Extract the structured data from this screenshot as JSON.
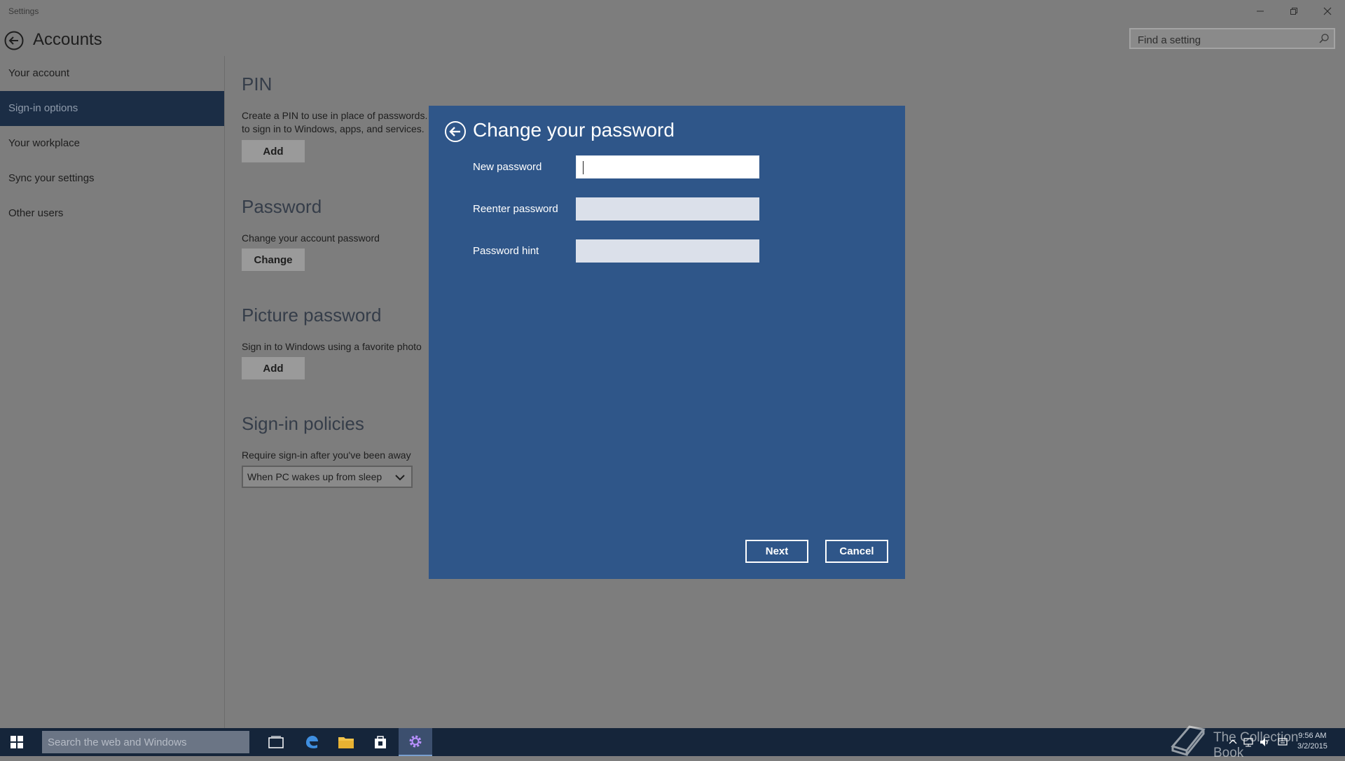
{
  "window": {
    "title": "Settings"
  },
  "header": {
    "title": "Accounts",
    "search_placeholder": "Find a setting"
  },
  "sidebar": {
    "items": [
      {
        "label": "Your account"
      },
      {
        "label": "Sign-in options",
        "active": true
      },
      {
        "label": "Your workplace"
      },
      {
        "label": "Sync your settings"
      },
      {
        "label": "Other users"
      }
    ]
  },
  "main": {
    "pin": {
      "title": "PIN",
      "desc_line1": "Create a PIN to use in place of passwords.",
      "desc_line2": "to sign in to Windows, apps, and services.",
      "button": "Add"
    },
    "password": {
      "title": "Password",
      "desc": "Change your account password",
      "button": "Change"
    },
    "picture_password": {
      "title": "Picture password",
      "desc": "Sign in to Windows using a favorite photo",
      "button": "Add"
    },
    "signin_policies": {
      "title": "Sign-in policies",
      "desc": "Require sign-in after you've been away",
      "dropdown_value": "When PC wakes up from sleep"
    }
  },
  "dialog": {
    "title": "Change your password",
    "fields": {
      "new_password": {
        "label": "New password",
        "value": ""
      },
      "reenter_password": {
        "label": "Reenter password",
        "value": ""
      },
      "password_hint": {
        "label": "Password hint",
        "value": ""
      }
    },
    "next_label": "Next",
    "cancel_label": "Cancel"
  },
  "taskbar": {
    "search_placeholder": "Search the web and Windows",
    "time": "9:56 AM",
    "date": "3/2/2015",
    "watermark": "The Collection Book"
  },
  "colors": {
    "dialog_bg": "#2f5689",
    "sidebar_active": "#1b2d45",
    "taskbar_bg": "#15253a",
    "overlay_bg": "#7d7d7d"
  }
}
